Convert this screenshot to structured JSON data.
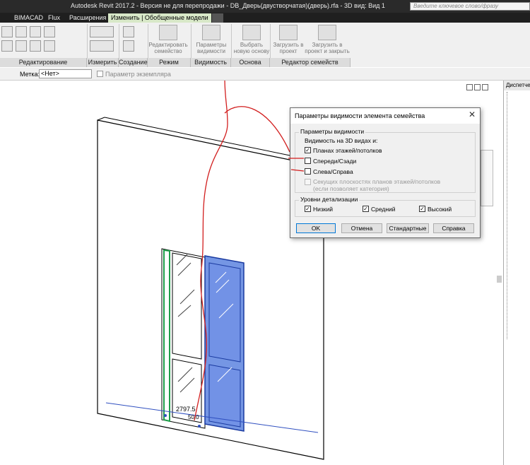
{
  "window": {
    "title": "Autodesk Revit 2017.2 - Версия не для перепродажи -    DB_Дверь(двустворчатая)(дверь).rfa - 3D вид: Вид 1",
    "search_placeholder": "Введите ключевое слово/фразу"
  },
  "ribbon": {
    "tabs": [
      "BIMACAD",
      "Flux",
      "Расширения",
      "Изменить | Обобщенные модели"
    ],
    "active_tab": "Изменить | Обобщенные модели",
    "panels": [
      "Редактирование",
      "Измерить",
      "Создание",
      "Режим",
      "Видимость",
      "Основа",
      "Редактор семейств"
    ],
    "buttons": {
      "edit_family": "Редактировать семейство",
      "visibility_settings": "Параметры видимости",
      "pick_new_host": "Выбрать новую основу",
      "load_into_project": "Загрузить в проект",
      "load_into_project_close": "Загрузить в проект и закрыть"
    }
  },
  "options_bar": {
    "label_label": "Метка:",
    "label_value": "<Нет>",
    "instance_param": "Параметр экземпляра"
  },
  "browser": {
    "header": "Диспетчер"
  },
  "canvas": {
    "dimension_text": "2797.5",
    "dimension_text_2": "50.0"
  },
  "dialog": {
    "title": "Параметры видимости элемента семейства",
    "group_visibility": "Параметры видимости",
    "visible_in_3d": "Видимость на 3D видах и:",
    "options": [
      {
        "label": "Планах этажей/потолков",
        "checked": true,
        "enabled": true
      },
      {
        "label": "Спереди/Сзади",
        "checked": false,
        "enabled": true
      },
      {
        "label": "Слева/Справа",
        "checked": false,
        "enabled": true
      },
      {
        "label": "Секущих плоскостях планов этажей/потолков",
        "checked": false,
        "enabled": false
      }
    ],
    "cut_note": "(если позволяет категория)",
    "group_detail": "Уровни детализации",
    "detail_levels": [
      {
        "label": "Низкий",
        "checked": true
      },
      {
        "label": "Средний",
        "checked": true
      },
      {
        "label": "Высокий",
        "checked": true
      }
    ],
    "buttons": {
      "ok": "OK",
      "cancel": "Отмена",
      "default": "Стандартные",
      "help": "Справка"
    },
    "close_glyph": "✕"
  },
  "colors": {
    "tab_active": "#d8e8c8",
    "door_selected": "#3a6ad8",
    "annotation_red": "#d21e1e"
  }
}
